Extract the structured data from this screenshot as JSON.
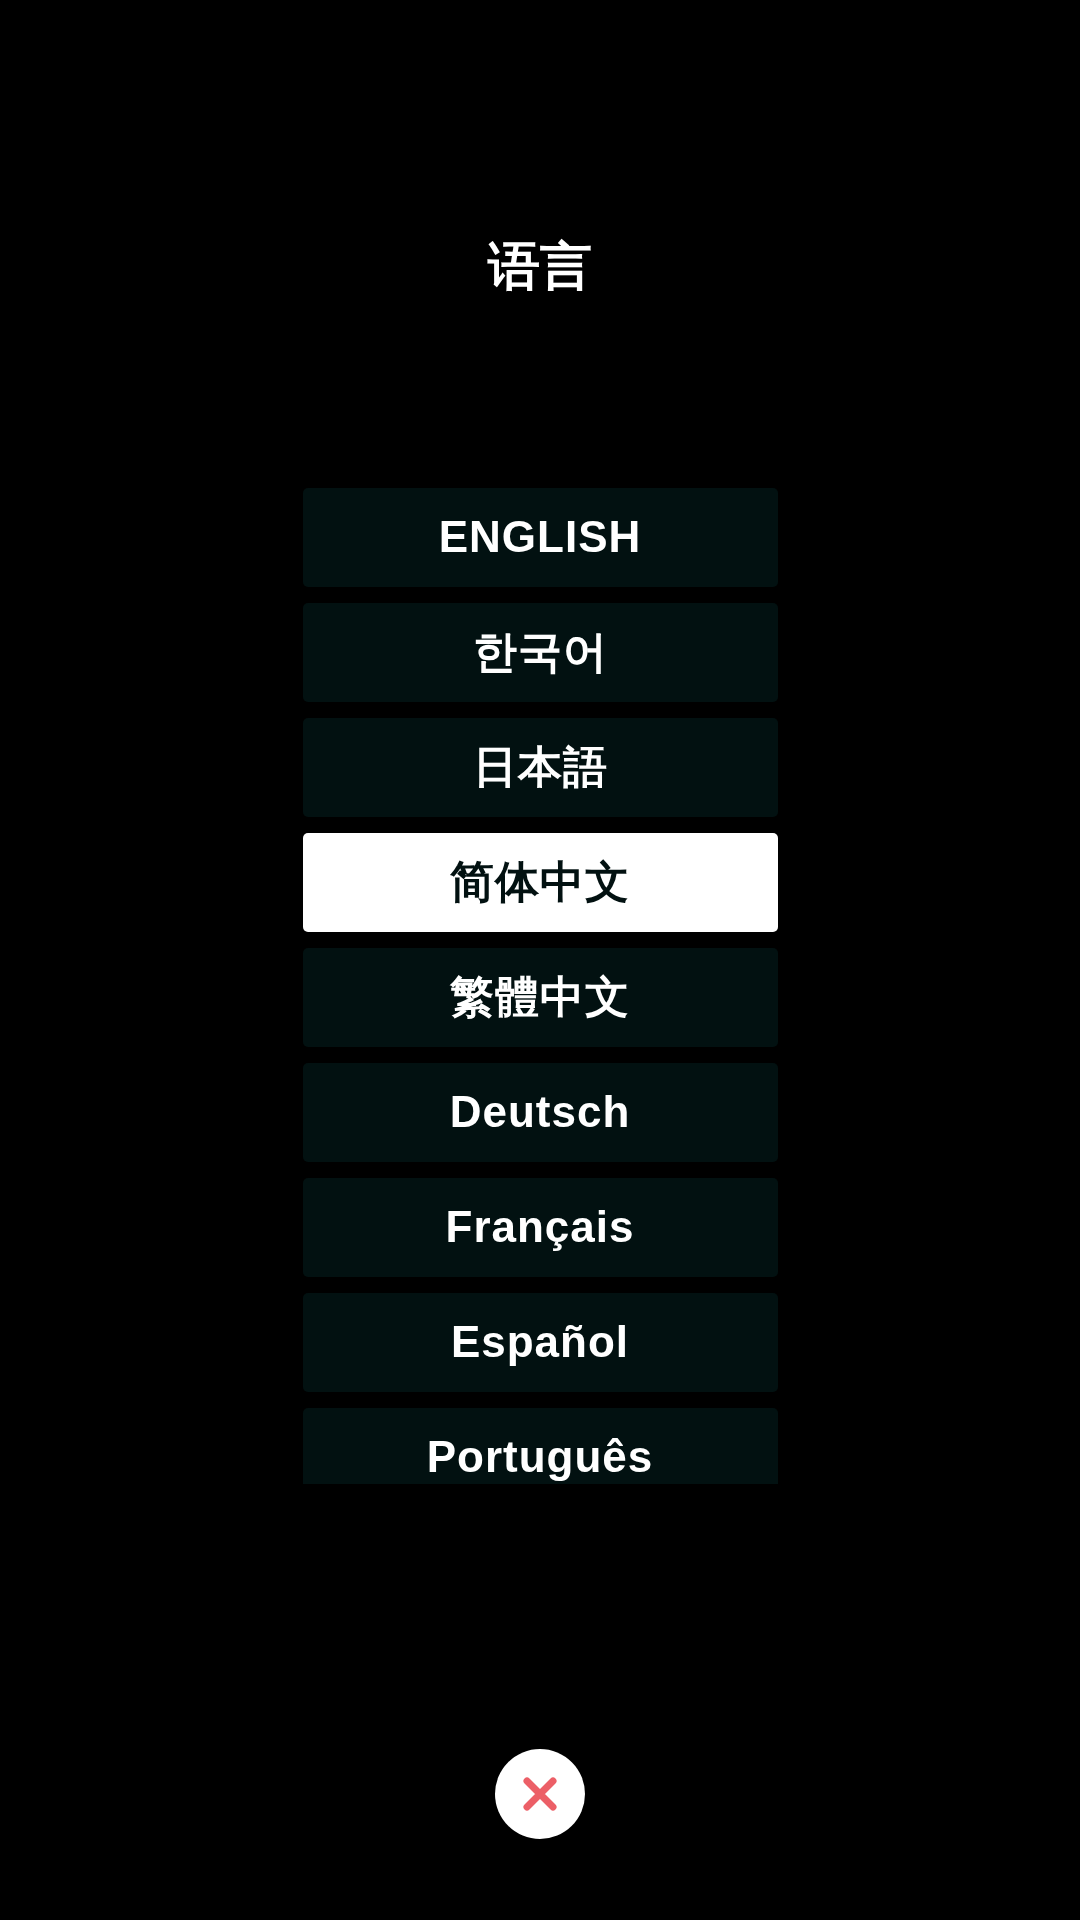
{
  "title": "语言",
  "languages": [
    {
      "label": "ENGLISH",
      "selected": false
    },
    {
      "label": "한국어",
      "selected": false
    },
    {
      "label": "日本語",
      "selected": false
    },
    {
      "label": "简体中文",
      "selected": true
    },
    {
      "label": "繁體中文",
      "selected": false
    },
    {
      "label": "Deutsch",
      "selected": false
    },
    {
      "label": "Français",
      "selected": false
    },
    {
      "label": "Español",
      "selected": false
    },
    {
      "label": "Português",
      "selected": false
    }
  ]
}
